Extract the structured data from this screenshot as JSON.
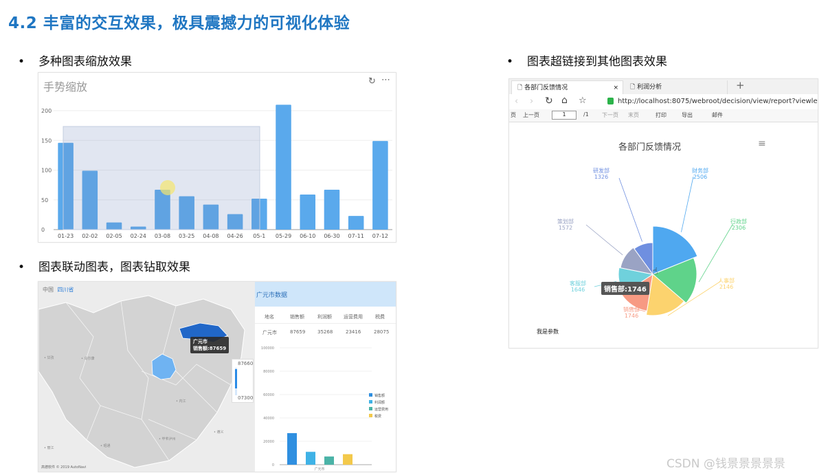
{
  "heading": "4.2 丰富的交互效果，极具震撼力的可视化体验",
  "bullets": {
    "b1": "多种图表缩放效果",
    "b2": "图表联动图表，图表钻取效果",
    "b3": "图表超链接到其他图表效果"
  },
  "zoom_panel": {
    "title": "手势缩放",
    "refresh_icon": "refresh-icon",
    "more_icon": "more-icon"
  },
  "map_panel": {
    "crumb1": "中国",
    "crumb2": "四川省",
    "city_label": "广元市",
    "tooltip": "销售额:87659",
    "range_max": "87660",
    "range_min": "07300",
    "table_title": "广元市数据",
    "headers": [
      "地名",
      "销售额",
      "利润额",
      "运营费用",
      "税费"
    ],
    "row": [
      "广元市",
      "87659",
      "35268",
      "23416",
      "28075"
    ],
    "bar_x_label": "广元市",
    "footer": "高德软件 © 2019 AutoNavi",
    "colors": {
      "sales": "#2f8fe0",
      "profit": "#3fb2e6",
      "op": "#4bb3a7",
      "tax": "#f3c94b"
    }
  },
  "browser": {
    "tab1": "各部门反馈情况",
    "tab2": "利润分析",
    "url": "http://localhost:8075/webroot/decision/view/report?viewlet=c",
    "toolbar": {
      "page_label": "页",
      "prev": "上一页",
      "page_input": "1",
      "total": "/1",
      "next": "下一页",
      "last": "末页",
      "print": "打印",
      "export": "导出",
      "mail": "邮件"
    },
    "chart_title": "各部门反馈情况",
    "tooltip": "销售部:1746",
    "footnote": "我是参数"
  },
  "watermark": "CSDN @钱景景景景景",
  "chart_data": [
    {
      "type": "bar",
      "title": "手势缩放",
      "categories": [
        "01-23",
        "02-02",
        "02-05",
        "02-24",
        "03-08",
        "03-25",
        "04-08",
        "04-26",
        "05-1",
        "05-29",
        "06-10",
        "06-30",
        "07-11",
        "07-12"
      ],
      "values": [
        146,
        99,
        12,
        5,
        67,
        56,
        42,
        26,
        52,
        210,
        59,
        67,
        23,
        149
      ],
      "ylim": [
        0,
        200
      ],
      "yticks": [
        "0",
        "50",
        "100",
        "150",
        "200"
      ],
      "grid": true,
      "color": "#5aa9ec"
    },
    {
      "type": "pie",
      "title": "各部门反馈情况",
      "labels": [
        "财务部",
        "行政部",
        "人事部",
        "销售部",
        "客服部",
        "策划部",
        "研发部"
      ],
      "values": [
        2506,
        2306,
        2146,
        1746,
        1646,
        1572,
        1326
      ],
      "colors": [
        "#4fa8f0",
        "#5fd38a",
        "#fcd36e",
        "#f79a83",
        "#6fd1dc",
        "#9aa3c4",
        "#6f8fe0"
      ]
    },
    {
      "type": "bar",
      "title": "广元市数据",
      "categories": [
        "广元市"
      ],
      "series": [
        {
          "name": "销售额",
          "values": [
            27000
          ]
        },
        {
          "name": "利润额",
          "values": [
            11000
          ]
        },
        {
          "name": "运营费用",
          "values": [
            7000
          ]
        },
        {
          "name": "税费",
          "values": [
            9000
          ]
        }
      ],
      "ylim": [
        0,
        100000
      ],
      "yticks": [
        "0",
        "20000",
        "40000",
        "60000",
        "80000",
        "100000"
      ]
    }
  ]
}
